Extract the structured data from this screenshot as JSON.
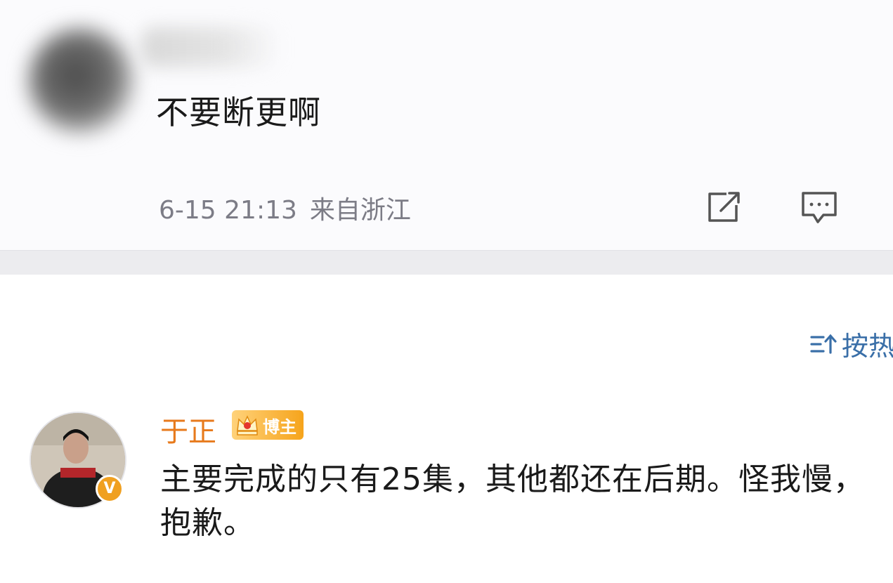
{
  "post": {
    "text": "不要断更啊",
    "time": "6-15 21:13",
    "location": "来自浙江",
    "actions": [
      {
        "icon": "share-icon"
      },
      {
        "icon": "comment-icon"
      }
    ]
  },
  "comments_header": {
    "sort_label": "按热",
    "sort_icon": "sort-icon"
  },
  "comment": {
    "author": "于正",
    "badge": "博主",
    "verified": "V",
    "text": "主要完成的只有25集，其他都还在后期。怪我慢，抱歉。"
  },
  "colors": {
    "accent": "#e77a1c",
    "link": "#3a6fa8",
    "separator": "#ececef",
    "meta": "#7c7c86"
  }
}
